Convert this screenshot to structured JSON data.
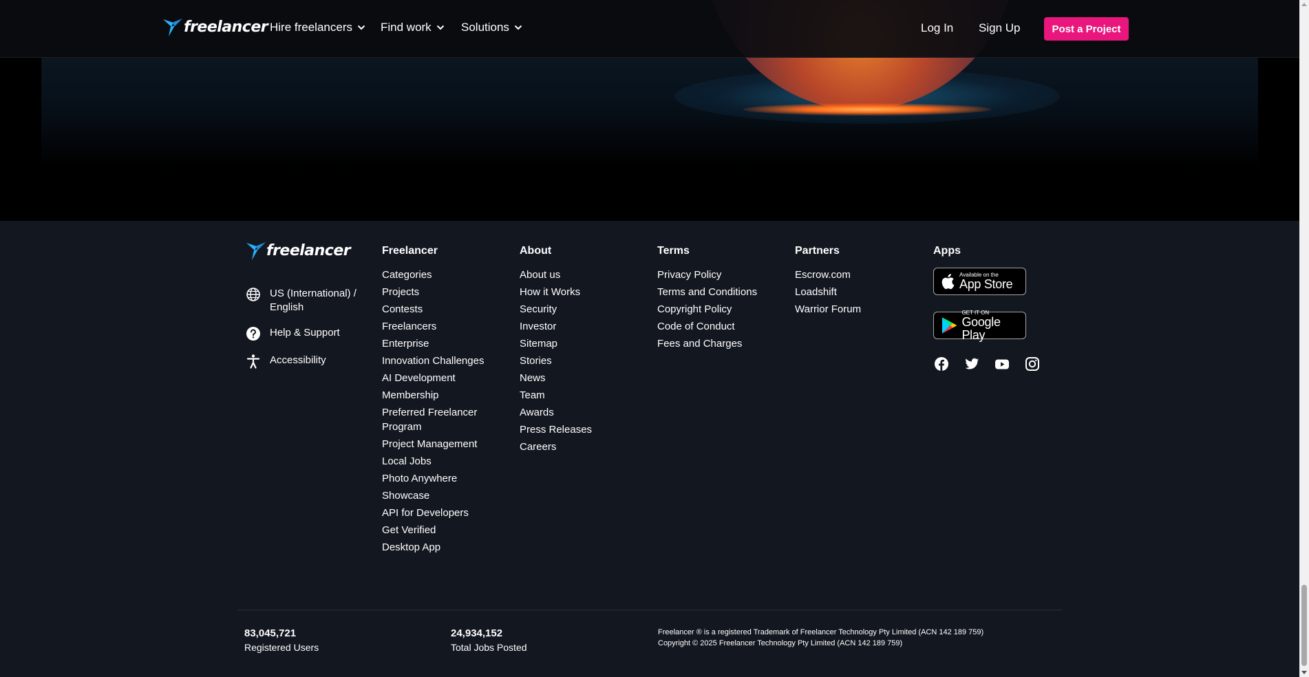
{
  "header": {
    "logo_text": "freelancer",
    "nav": [
      {
        "label": "Hire freelancers"
      },
      {
        "label": "Find work"
      },
      {
        "label": "Solutions"
      }
    ],
    "login": "Log In",
    "signup": "Sign Up",
    "post_project": "Post a Project"
  },
  "colors": {
    "accent": "#e8167d",
    "logo_blue": "#29b2fe",
    "footer_bg": "#131720"
  },
  "footer": {
    "logo_text": "freelancer",
    "side": {
      "language": "US (International) / English",
      "help": "Help & Support",
      "accessibility": "Accessibility"
    },
    "columns": [
      {
        "title": "Freelancer",
        "links": [
          "Categories",
          "Projects",
          "Contests",
          "Freelancers",
          "Enterprise",
          "Innovation Challenges",
          "AI Development",
          "Membership",
          "Preferred Freelancer Program",
          "Project Management",
          "Local Jobs",
          "Photo Anywhere",
          "Showcase",
          "API for Developers",
          "Get Verified",
          "Desktop App"
        ]
      },
      {
        "title": "About",
        "links": [
          "About us",
          "How it Works",
          "Security",
          "Investor",
          "Sitemap",
          "Stories",
          "News",
          "Team",
          "Awards",
          "Press Releases",
          "Careers"
        ]
      },
      {
        "title": "Terms",
        "links": [
          "Privacy Policy",
          "Terms and Conditions",
          "Copyright Policy",
          "Code of Conduct",
          "Fees and Charges"
        ]
      },
      {
        "title": "Partners",
        "links": [
          "Escrow.com",
          "Loadshift",
          "Warrior Forum"
        ]
      }
    ],
    "apps": {
      "title": "Apps",
      "appstore_small": "Available on the",
      "appstore_big": "App Store",
      "googleplay_small": "GET IT ON",
      "googleplay_big": "Google Play",
      "socials": [
        "facebook-icon",
        "twitter-icon",
        "youtube-icon",
        "instagram-icon"
      ]
    },
    "stats": [
      {
        "value": "83,045,721",
        "label": "Registered Users"
      },
      {
        "value": "24,934,152",
        "label": "Total Jobs Posted"
      }
    ],
    "legal": [
      "Freelancer ® is a registered Trademark of Freelancer Technology Pty Limited (ACN 142 189 759)",
      "Copyright © 2025 Freelancer Technology Pty Limited (ACN 142 189 759)"
    ]
  }
}
